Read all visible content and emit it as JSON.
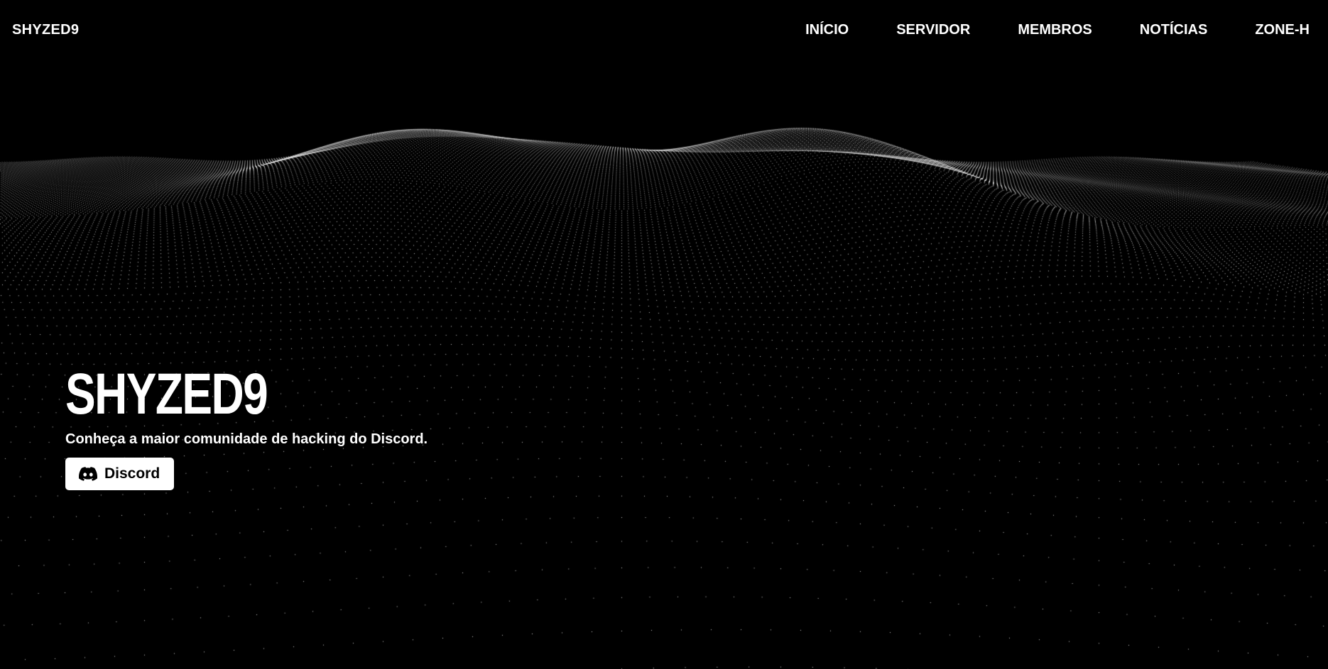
{
  "header": {
    "brand": "SHYZED9",
    "nav": [
      {
        "label": "INÍCIO"
      },
      {
        "label": "SERVIDOR"
      },
      {
        "label": "MEMBROS"
      },
      {
        "label": "NOTÍCIAS"
      },
      {
        "label": "ZONE-H"
      }
    ]
  },
  "hero": {
    "title": "SHYZED9",
    "subtitle": "Conheça a maior comunidade de hacking do Discord.",
    "button_label": "Discord",
    "button_icon": "discord-icon"
  },
  "background": {
    "type": "particle-wave",
    "dot_color": "#ffffff",
    "bg_color": "#000000"
  }
}
